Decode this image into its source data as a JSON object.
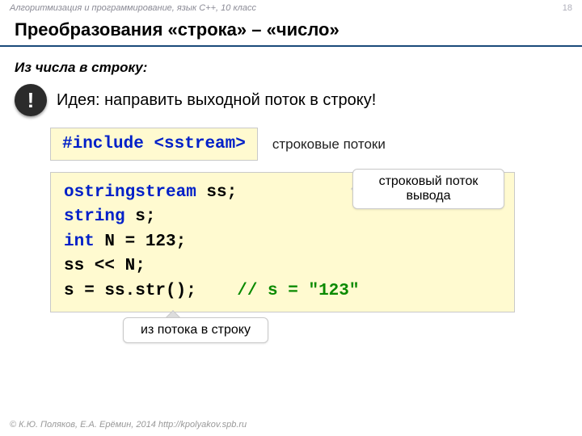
{
  "header": {
    "course": "Алгоритмизация и программирование, язык C++, 10 класс",
    "page": "18"
  },
  "title": "Преобразования «строка» – «число»",
  "subheading": "Из числа в строку:",
  "idea": {
    "bang": "!",
    "text": "Идея: направить выходной поток в строку!"
  },
  "include": {
    "directive": "#include",
    "header": "<sstream>",
    "label": "строковые потоки"
  },
  "code": {
    "l1a": "ostringstream",
    "l1b": " ss;",
    "l2a": "string",
    "l2b": " s;",
    "l3a": "int",
    "l3b": " N = 123;",
    "l4": "ss << N;",
    "l5a": "s = ss.str();",
    "l5c": "// s = \"123\""
  },
  "callouts": {
    "stream_out_l1": "строковый поток",
    "stream_out_l2": "вывода",
    "tostring": "из потока в строку"
  },
  "footer": "© К.Ю. Поляков, Е.А. Ерёмин, 2014   http://kpolyakov.spb.ru"
}
